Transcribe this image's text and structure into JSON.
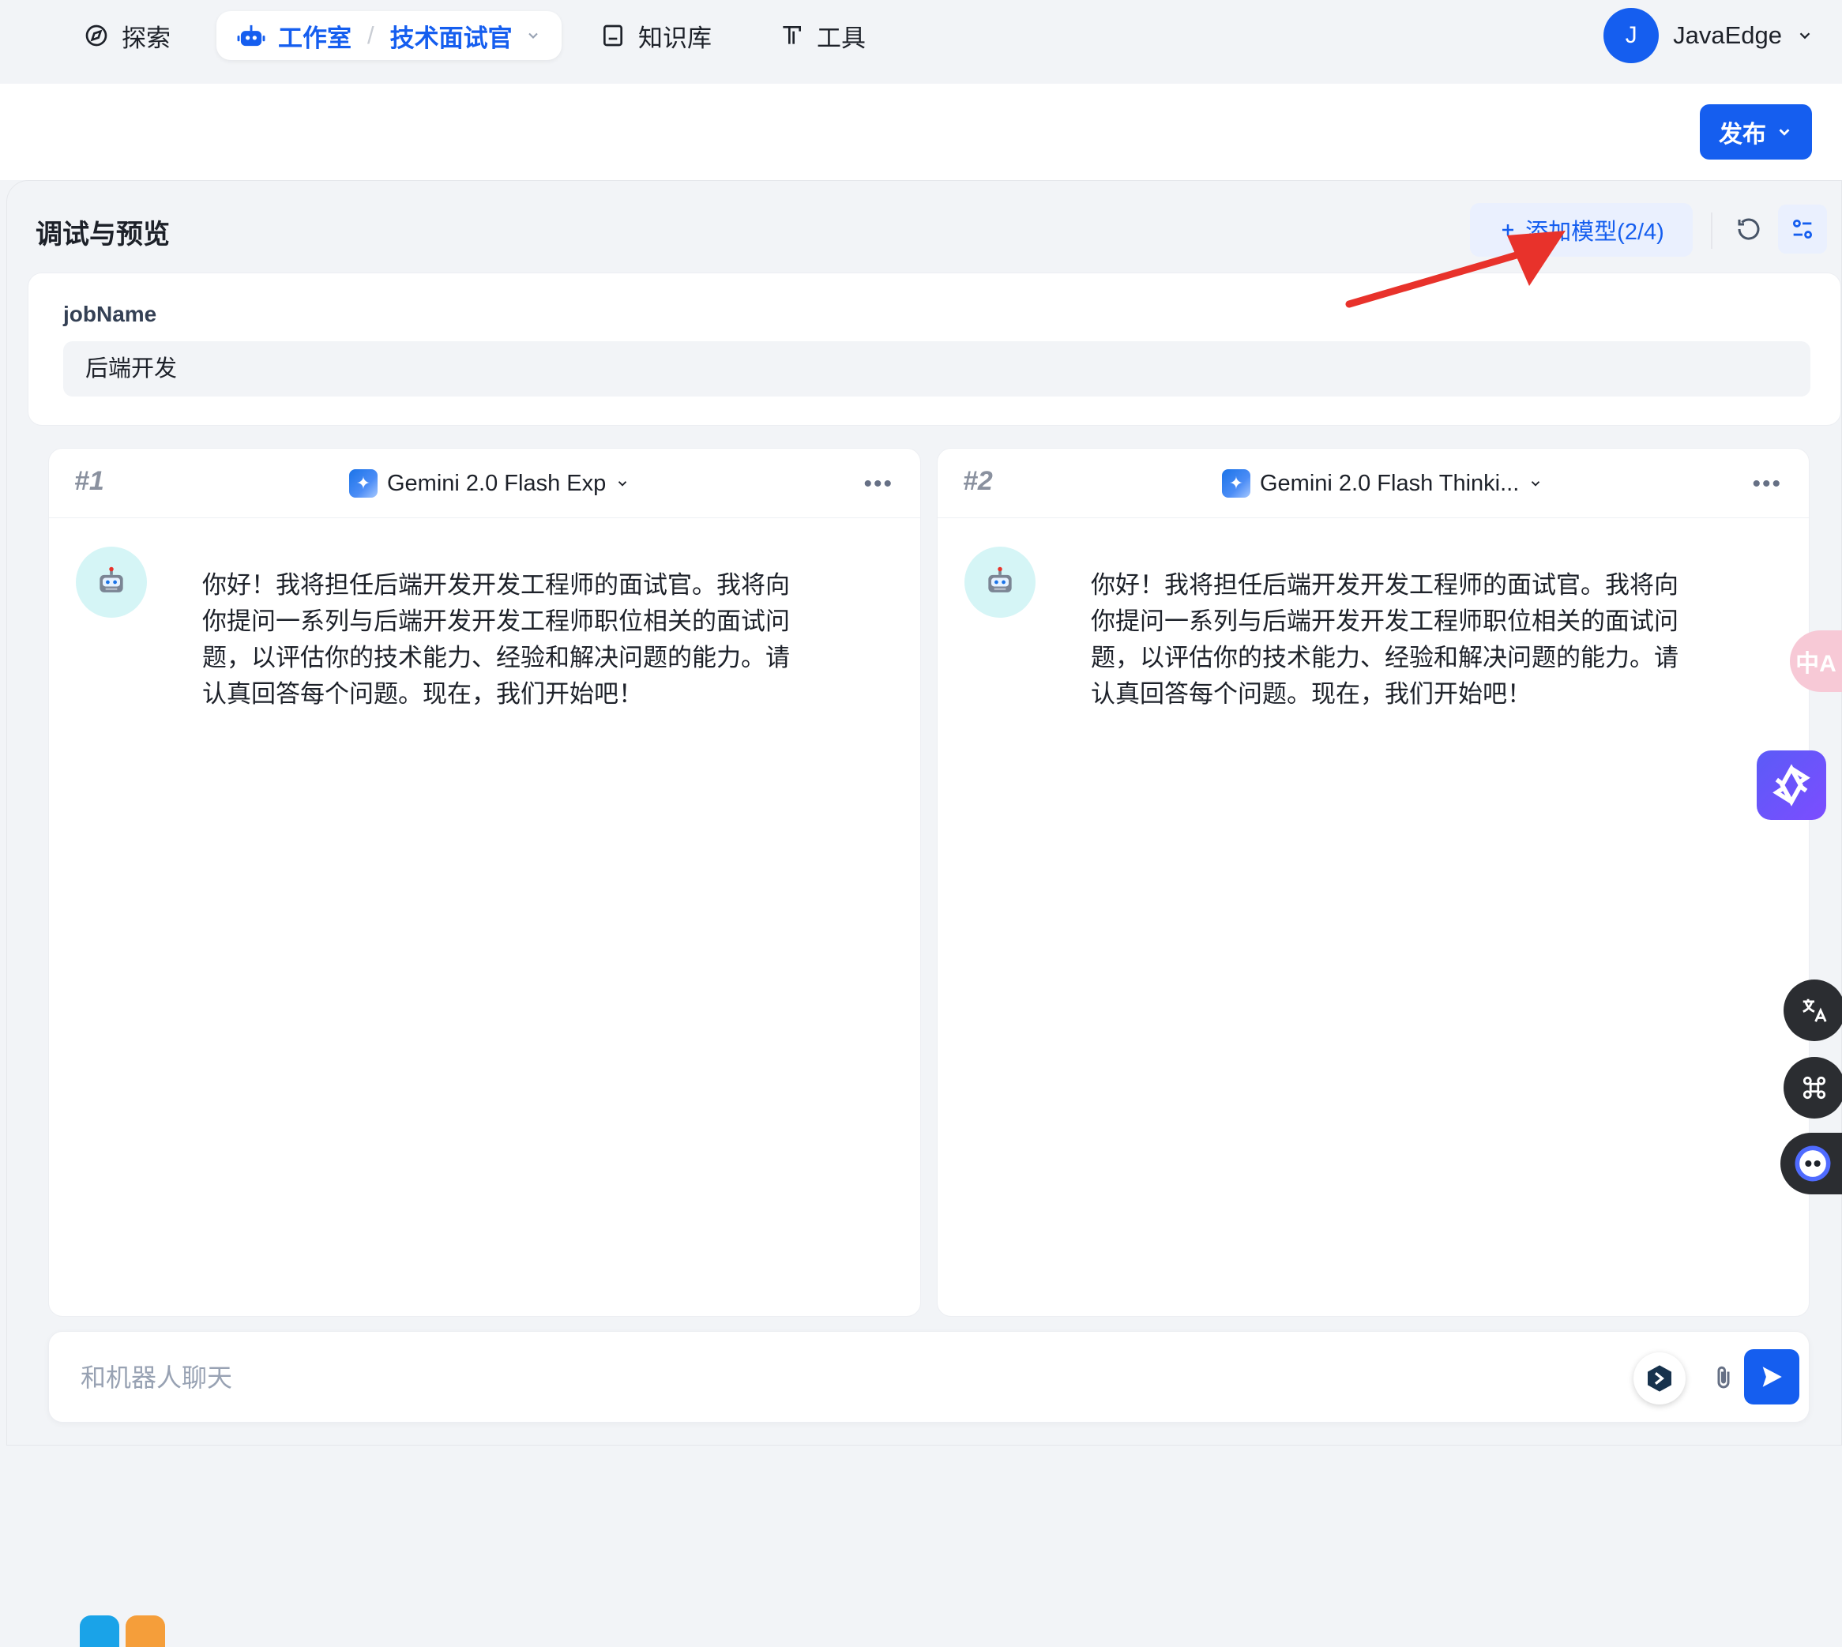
{
  "nav": {
    "explore": "探索",
    "studio": "工作室",
    "app_name": "技术面试官",
    "knowledge": "知识库",
    "tools": "工具",
    "user_initial": "J",
    "user_name": "JavaEdge"
  },
  "header": {
    "publish_label": "发布"
  },
  "debug": {
    "title": "调试与预览",
    "add_model_label": "添加模型(2/4)"
  },
  "variables": {
    "label": "jobName",
    "value": "后端开发"
  },
  "models": [
    {
      "index": "#1",
      "name": "Gemini 2.0 Flash Exp",
      "message": "你好！我将担任后端开发开发工程师的面试官。我将向你提问一系列与后端开发开发工程师职位相关的面试问题，以评估你的技术能力、经验和解决问题的能力。请认真回答每个问题。现在，我们开始吧！"
    },
    {
      "index": "#2",
      "name": "Gemini 2.0 Flash Thinki...",
      "message": "你好！我将担任后端开发开发工程师的面试官。我将向你提问一系列与后端开发开发工程师职位相关的面试问题，以评估你的技术能力、经验和解决问题的能力。请认真回答每个问题。现在，我们开始吧！"
    }
  ],
  "chat": {
    "placeholder": "和机器人聊天"
  },
  "side": {
    "translate_badge": "中A"
  },
  "colors": {
    "primary": "#155eef",
    "background": "#f2f4f7",
    "annotation": "#e8322b"
  }
}
